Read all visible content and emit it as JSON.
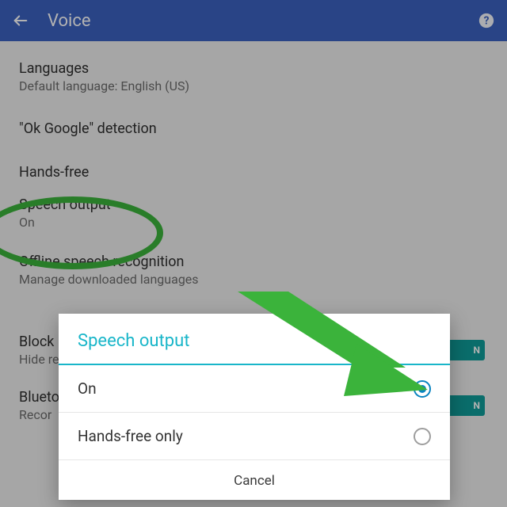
{
  "appbar": {
    "title": "Voice"
  },
  "settings": {
    "languages": {
      "title": "Languages",
      "subtitle": "Default language: English (US)"
    },
    "okgoogle": {
      "title": "\"Ok Google\" detection"
    },
    "handsfree": {
      "title": "Hands-free"
    },
    "speechout": {
      "title": "Speech output",
      "subtitle": "On"
    },
    "offline": {
      "title": "Offline speech recognition",
      "subtitle": "Manage downloaded languages"
    },
    "block": {
      "title_prefix": "Block",
      "subtitle_prefix": "Hide re",
      "switch": "N"
    },
    "bluetooth": {
      "title_prefix": "Blueto",
      "subtitle_prefix": "Recor",
      "switch": "N"
    }
  },
  "dialog": {
    "title": "Speech output",
    "options": [
      {
        "label": "On",
        "checked": true
      },
      {
        "label": "Hands-free only",
        "checked": false
      }
    ],
    "cancel": "Cancel"
  },
  "colors": {
    "appbar": "#3b62c0",
    "accent_teal": "#19b6c9",
    "radio_checked": "#0a84c1",
    "annotation_green": "#3bb33b",
    "switch_green": "#0f9d9a"
  }
}
